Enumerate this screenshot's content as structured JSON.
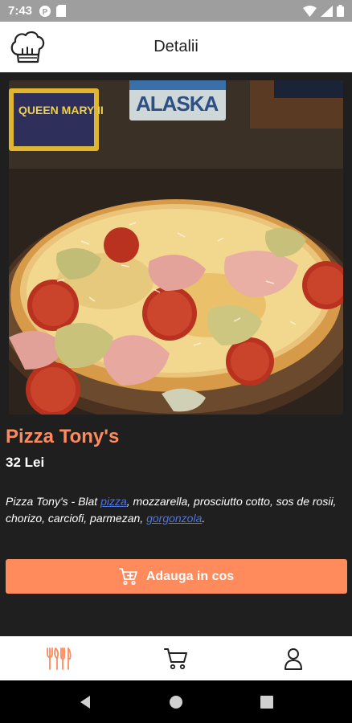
{
  "status_bar": {
    "time": "7:43",
    "left_icons": [
      "notification-p-icon",
      "sim-card-icon"
    ],
    "right_icons": [
      "wifi-icon",
      "signal-icon",
      "battery-icon"
    ]
  },
  "app_bar": {
    "title": "Detalii",
    "logo_icon": "chef-hat-icon"
  },
  "product": {
    "image_icon": "pizza-photo",
    "photo_signs": [
      "QUEEN MARY II",
      "ALASKA"
    ],
    "name": "Pizza Tony's",
    "price": "32 Lei",
    "description": {
      "part1": "Pizza Tony's - Blat ",
      "link1": "pizza",
      "part2": ", mozzarella, prosciutto cotto, sos de rosii, chorizo, carciofi, parmezan, ",
      "link2": "gorgonzola",
      "part3": "."
    }
  },
  "add_to_cart": {
    "label": "Adauga in cos",
    "icon": "cart-plus-icon"
  },
  "bottom_nav": {
    "items": [
      {
        "icon": "cutlery-icon",
        "active": true
      },
      {
        "icon": "cart-icon",
        "active": false
      },
      {
        "icon": "user-icon",
        "active": false
      }
    ]
  },
  "colors": {
    "accent": "#ff8a5b",
    "background": "#1f1f1f",
    "link": "#4e74e0",
    "status_bar": "#9e9e9e"
  }
}
